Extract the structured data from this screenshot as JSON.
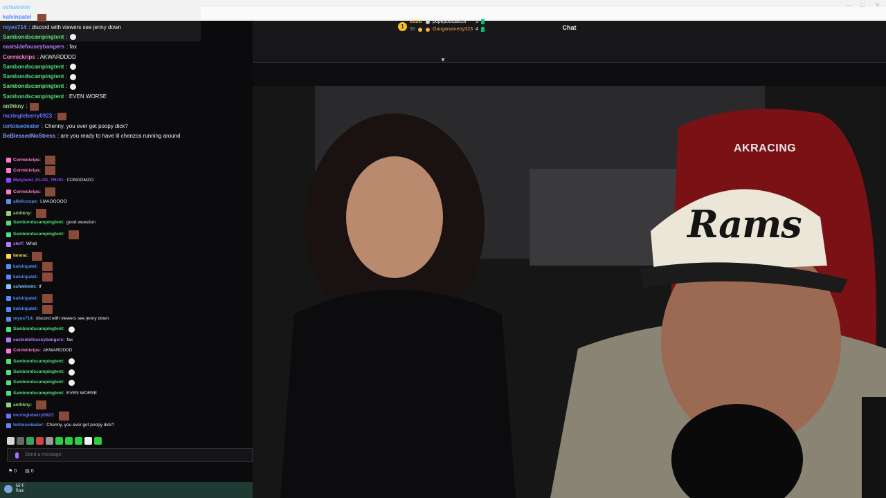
{
  "chat": {
    "title": "Chat",
    "leaderboard": [
      {
        "rank_label": "1",
        "name": "Eddie",
        "points": "50",
        "other": "popupoutdatcut",
        "other_points": "5"
      },
      {
        "name": "Ganganometry323",
        "points": "4"
      }
    ],
    "messages": [
      {
        "user": "schwinnin",
        "text": ": tf",
        "color": "#7ec8ff"
      },
      {
        "user": "kalvinpatel",
        "text": ":",
        "color": "#4f8bff",
        "emote": true
      },
      {
        "user": "reyes714",
        "text": ": discord with viewers see jenny down",
        "color": "#5b8def"
      },
      {
        "user": "Sambondscampingtent",
        "text": ":",
        "color": "#4ee07a",
        "face": true
      },
      {
        "user": "eastsidefouseybangers",
        "text": ": fax",
        "color": "#b57bff"
      },
      {
        "user": "Cormickrips",
        "text": ": AKWARDDDD",
        "color": "#ff7bd0"
      },
      {
        "user": "Sambondscampingtent",
        "text": ":",
        "color": "#4ee07a",
        "face": true
      },
      {
        "user": "Sambondscampingtent",
        "text": ":",
        "color": "#4ee07a",
        "face": true
      },
      {
        "user": "Sambondscampingtent",
        "text": ":",
        "color": "#4ee07a",
        "face": true
      },
      {
        "user": "Sambondscampingtent",
        "text": ": EVEN WORSE",
        "color": "#4ee07a"
      },
      {
        "user": "anthkny",
        "text": ":",
        "color": "#8fd17f",
        "emote": true
      },
      {
        "user": "mcringleberry0923",
        "text": ":",
        "color": "#6f6fff",
        "emote": true
      },
      {
        "user": "tortoisedealer",
        "text": ": Chenny, you ever get poopy dick?",
        "color": "#5b8def"
      },
      {
        "user": "BeBlessedNoStress",
        "text": ": are you ready to have lil chenzos running around",
        "color": "#8a9bff"
      }
    ],
    "small_messages": [
      {
        "user": "Cormickrips:",
        "text": "",
        "color": "#ff7bd0",
        "emote": true
      },
      {
        "user": "Cormickrips:",
        "text": "",
        "color": "#ff7bd0",
        "emote": true
      },
      {
        "user": "Maryland_PLUG_THUG:",
        "text": "CONDOMZO",
        "color": "#9147ff"
      },
      {
        "user": "Cormickrips:",
        "text": "",
        "color": "#ff7bd0",
        "emote": true
      },
      {
        "user": "allblicoupe:",
        "text": "LMAOOOOO",
        "color": "#5b8def"
      },
      {
        "user": "anthkny:",
        "text": "",
        "color": "#8fd17f",
        "emote": true
      },
      {
        "user": "Sambondscampingtent:",
        "text": "good wuestion",
        "color": "#4ee07a"
      },
      {
        "user": "Sambondscampingtent:",
        "text": "",
        "color": "#4ee07a",
        "emote": true
      },
      {
        "user": "slerf:",
        "text": "What",
        "color": "#b57bff"
      },
      {
        "user": "larana:",
        "text": "",
        "color": "#ffd84f",
        "emote": true
      },
      {
        "user": "kalvinpatel:",
        "text": "",
        "color": "#4f8bff",
        "emote": true
      },
      {
        "user": "kalvinpatel:",
        "text": "",
        "color": "#4f8bff",
        "emote": true
      },
      {
        "user": "schwinnin:",
        "text": "tf",
        "color": "#7ec8ff"
      },
      {
        "user": "kalvinpatel:",
        "text": "",
        "color": "#4f8bff",
        "emote": true
      },
      {
        "user": "kalvinpatel:",
        "text": "",
        "color": "#4f8bff",
        "emote": true
      },
      {
        "user": "reyes714:",
        "text": "discord with viewers see jenny down",
        "color": "#5b8def"
      },
      {
        "user": "Sambondscampingtent:",
        "text": "",
        "color": "#4ee07a",
        "face": true
      },
      {
        "user": "eastsidefouseybangers:",
        "text": "fax",
        "color": "#b57bff"
      },
      {
        "user": "Cormickrips:",
        "text": "AKWARDDDD",
        "color": "#ff7bd0"
      },
      {
        "user": "Sambondscampingtent:",
        "text": "",
        "color": "#4ee07a",
        "face": true
      },
      {
        "user": "Sambondscampingtent:",
        "text": "",
        "color": "#4ee07a",
        "face": true
      },
      {
        "user": "Sambondscampingtent:",
        "text": "",
        "color": "#4ee07a",
        "face": true
      },
      {
        "user": "Sambondscampingtent:",
        "text": "EVEN WORSE",
        "color": "#4ee07a"
      },
      {
        "user": "anthkny:",
        "text": "",
        "color": "#8fd17f",
        "emote": true
      },
      {
        "user": "mcringleberry0927:",
        "text": "",
        "color": "#6f6fff",
        "emote": true
      },
      {
        "user": "tortoisedealer:",
        "text": "Chenny, you ever get poopy dick?",
        "color": "#5b8def"
      }
    ],
    "input_placeholder": "Send a message",
    "footer_points": "0",
    "footer_count": "0"
  },
  "stream": {
    "hat_text": "Rams",
    "chair_brand": "AKRACING"
  },
  "taskbar": {
    "weather_temp": "55°F",
    "weather_desc": "Rain"
  }
}
